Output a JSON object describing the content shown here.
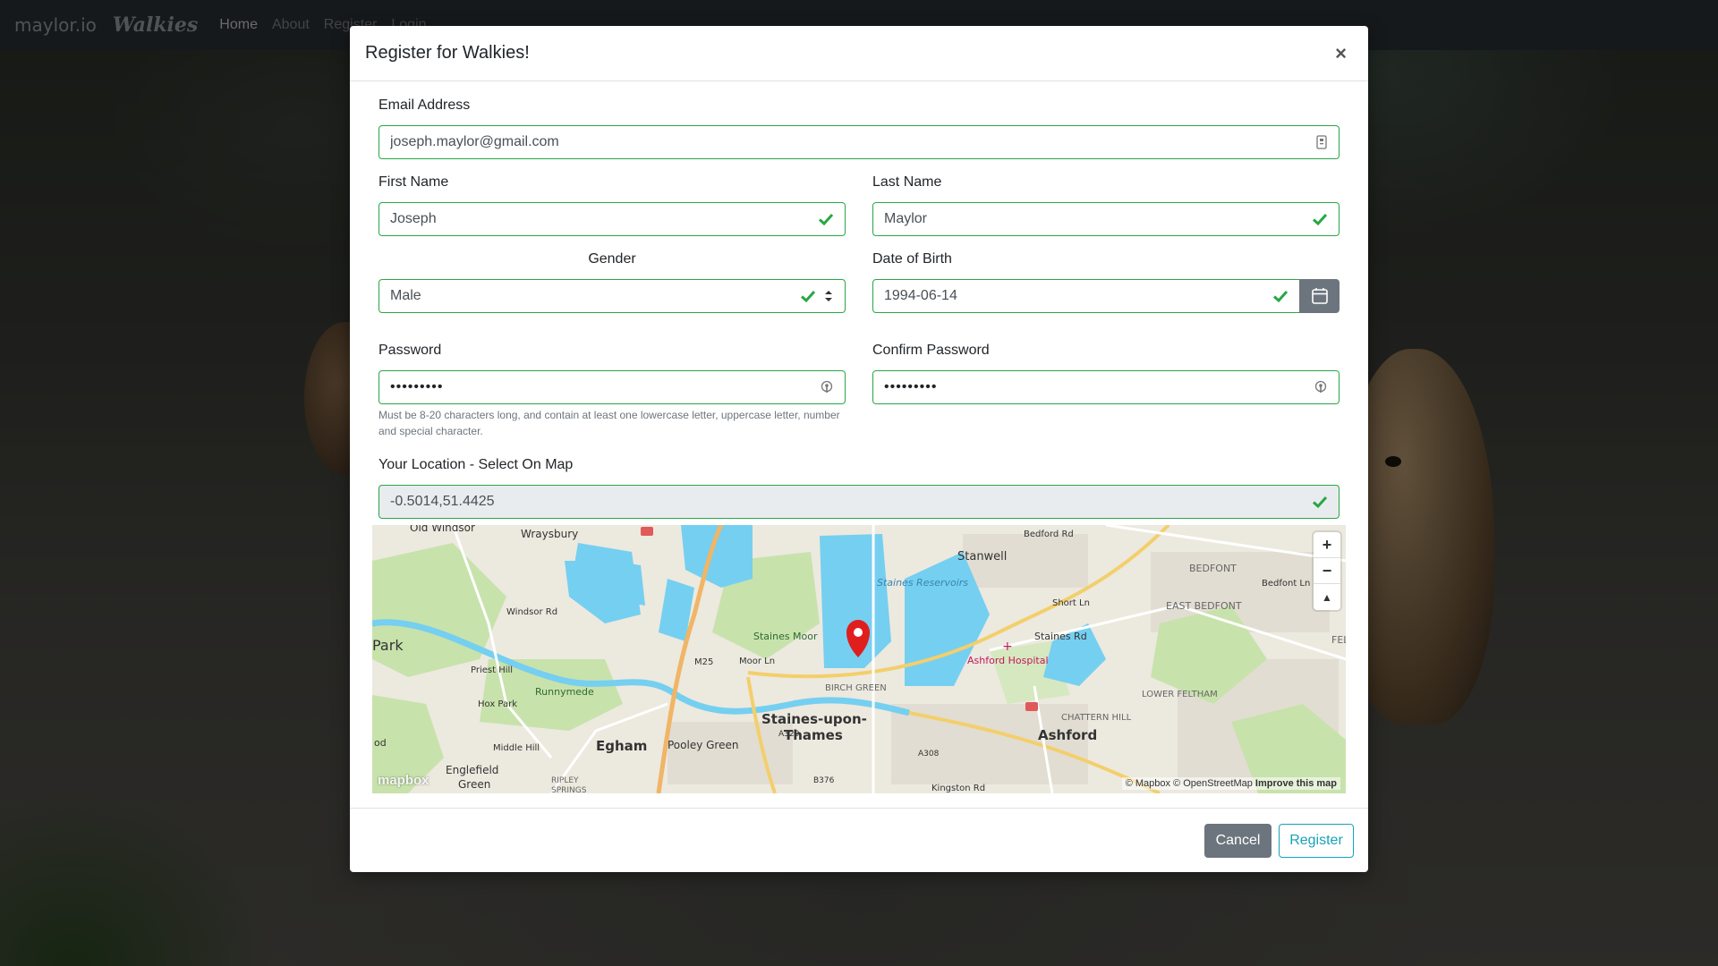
{
  "navbar": {
    "brand": "maylor.io",
    "brand_script": "Walkies",
    "links": [
      "Home",
      "About",
      "Register",
      "Login"
    ]
  },
  "modal": {
    "title": "Register for Walkies!",
    "close_symbol": "×"
  },
  "form": {
    "email": {
      "label": "Email Address",
      "value": "joseph.maylor@gmail.com"
    },
    "first_name": {
      "label": "First Name",
      "value": "Joseph"
    },
    "last_name": {
      "label": "Last Name",
      "value": "Maylor"
    },
    "gender": {
      "label": "Gender",
      "value": "Male"
    },
    "dob": {
      "label": "Date of Birth",
      "value": "1994-06-14"
    },
    "password": {
      "label": "Password",
      "value": "•••••••••"
    },
    "confirm_password": {
      "label": "Confirm Password",
      "value": "•••••••••"
    },
    "password_help": "Must be 8-20 characters long, and contain at least one lowercase letter, uppercase letter, number and special character.",
    "location": {
      "label": "Your Location - Select On Map",
      "value": "-0.5014,51.4425"
    }
  },
  "map": {
    "labels": [
      "Old Windsor",
      "Wraysbury",
      "Bedford Rd",
      "Stanwell",
      "BEDFONT",
      "Bedfont Ln",
      "Staines Reservoirs",
      "Short Ln",
      "EAST BEDFONT",
      "Staines Rd",
      "FELTHA",
      "Park",
      "Windsor Rd",
      "Priest Hill",
      "Staines Moor",
      "Ashford Hospital",
      "M25",
      "Moor Ln",
      "Runnymede",
      "Hox Park",
      "BIRCH GREEN",
      "LOWER FELTHAM",
      "CHATTERN HILL",
      "Staines-upon-",
      "Thames",
      "A320",
      "Egham",
      "Pooley Green",
      "A308",
      "Ashford",
      "Middle Hill",
      "Englefield",
      "Green",
      "RIPLEY",
      "SPRINGS",
      "B376",
      "Kingston Rd",
      "od"
    ],
    "attribution_prefix": "© Mapbox © OpenStreetMap",
    "attribution_link": "Improve this map",
    "logo": "mapbox",
    "zoom_in": "+",
    "zoom_out": "−",
    "compass": "▲"
  },
  "footer": {
    "cancel_label": "Cancel",
    "register_label": "Register"
  },
  "colors": {
    "valid": "#28a745",
    "navbar": "#2b3035",
    "cancel": "#6c757d",
    "register": "#17a2b8",
    "water": "#75cff0",
    "park": "#c8e2ac",
    "marker": "#e01e1e"
  }
}
